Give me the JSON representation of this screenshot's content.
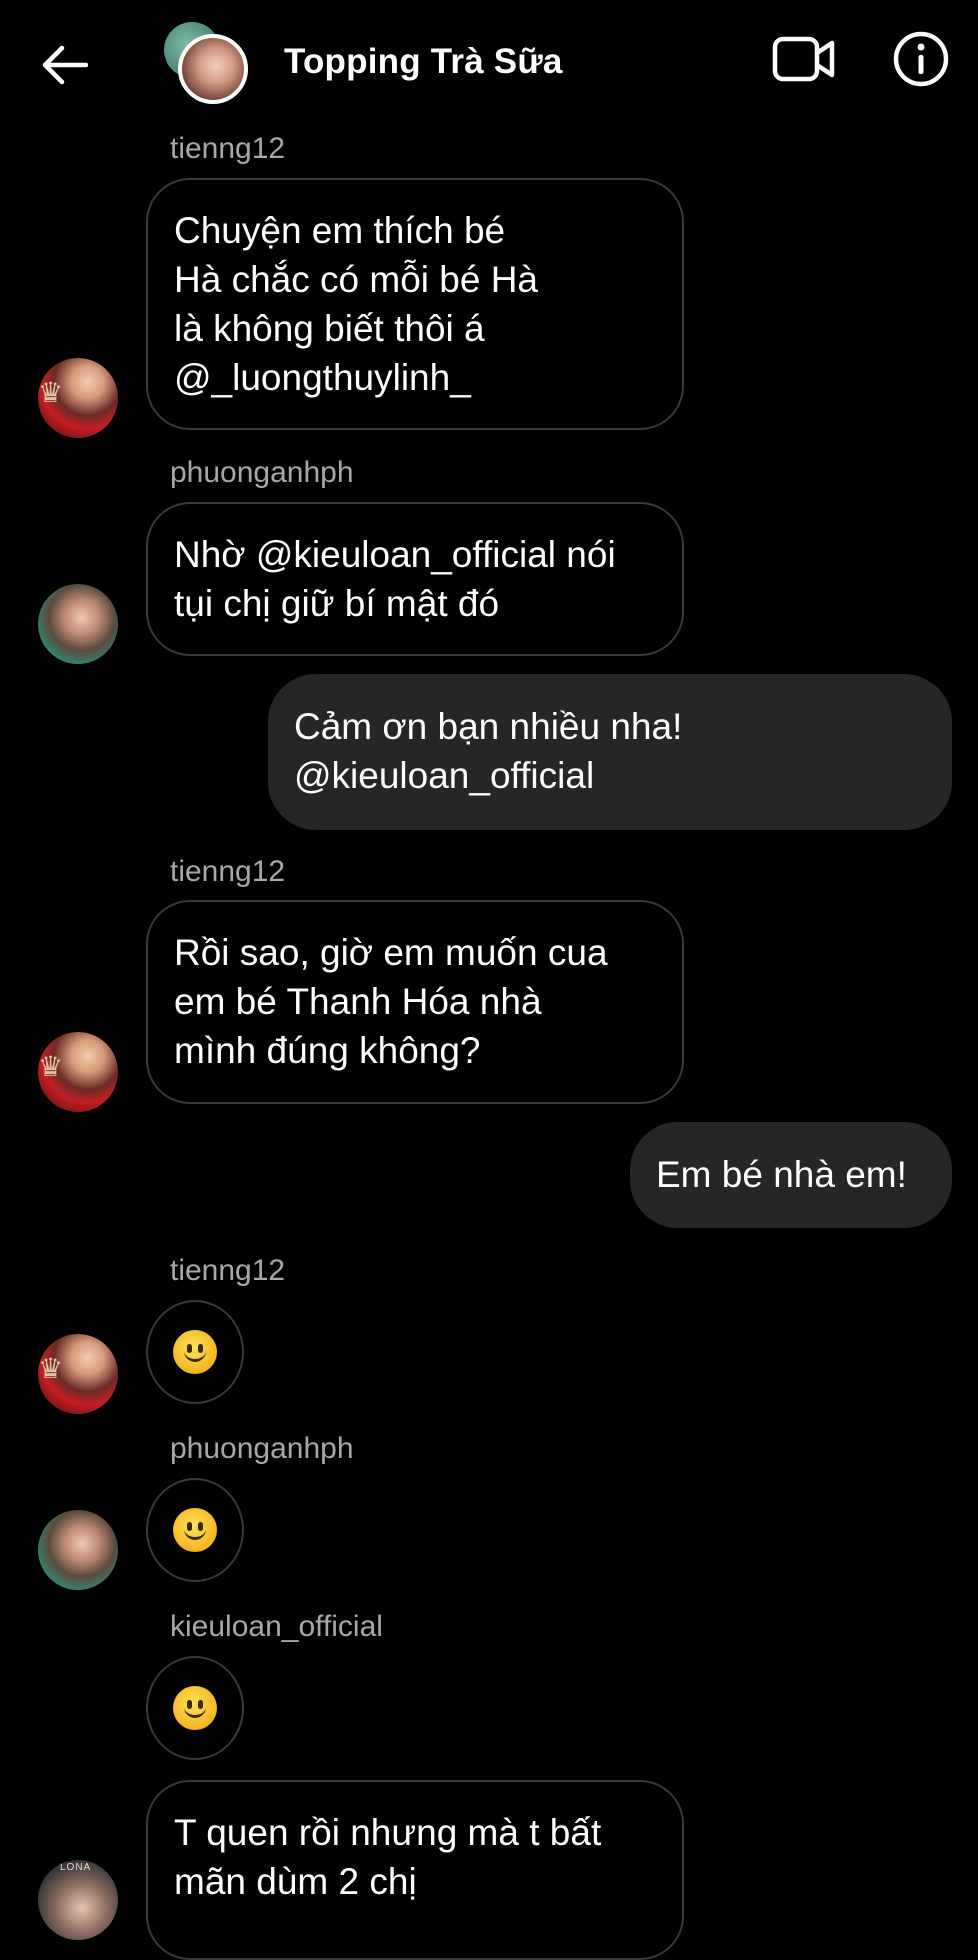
{
  "header": {
    "title": "Topping Trà Sữa"
  },
  "messages": [
    {
      "sender": "tienng12",
      "lines": [
        "Chuyện em thích bé",
        "Hà chắc có mỗi bé Hà",
        "là không biết thôi á",
        "@_luongthuylinh_"
      ]
    },
    {
      "sender": "phuonganhph",
      "lines": [
        "Nhờ @kieuloan_official nói",
        "tụi chị giữ bí mật đó"
      ]
    },
    {
      "outgoing": true,
      "lines": [
        "Cảm ơn bạn nhiều nha!",
        "@kieuloan_official"
      ]
    },
    {
      "sender": "tienng12",
      "lines": [
        "Rồi sao, giờ em muốn cua",
        "em bé Thanh Hóa nhà",
        "mình đúng không?"
      ]
    },
    {
      "outgoing": true,
      "lines": [
        "Em bé nhà em!"
      ]
    },
    {
      "sender": "tienng12",
      "emoji": "slightly-smiling-face"
    },
    {
      "sender": "phuonganhph",
      "emoji": "slightly-smiling-face"
    },
    {
      "sender": "kieuloan_official",
      "emoji": "slightly-smiling-face"
    },
    {
      "sender": "",
      "lines": [
        "T quen rồi nhưng mà t bất",
        "mãn dùm 2 chị"
      ]
    }
  ],
  "avatar_badge": "LONA"
}
